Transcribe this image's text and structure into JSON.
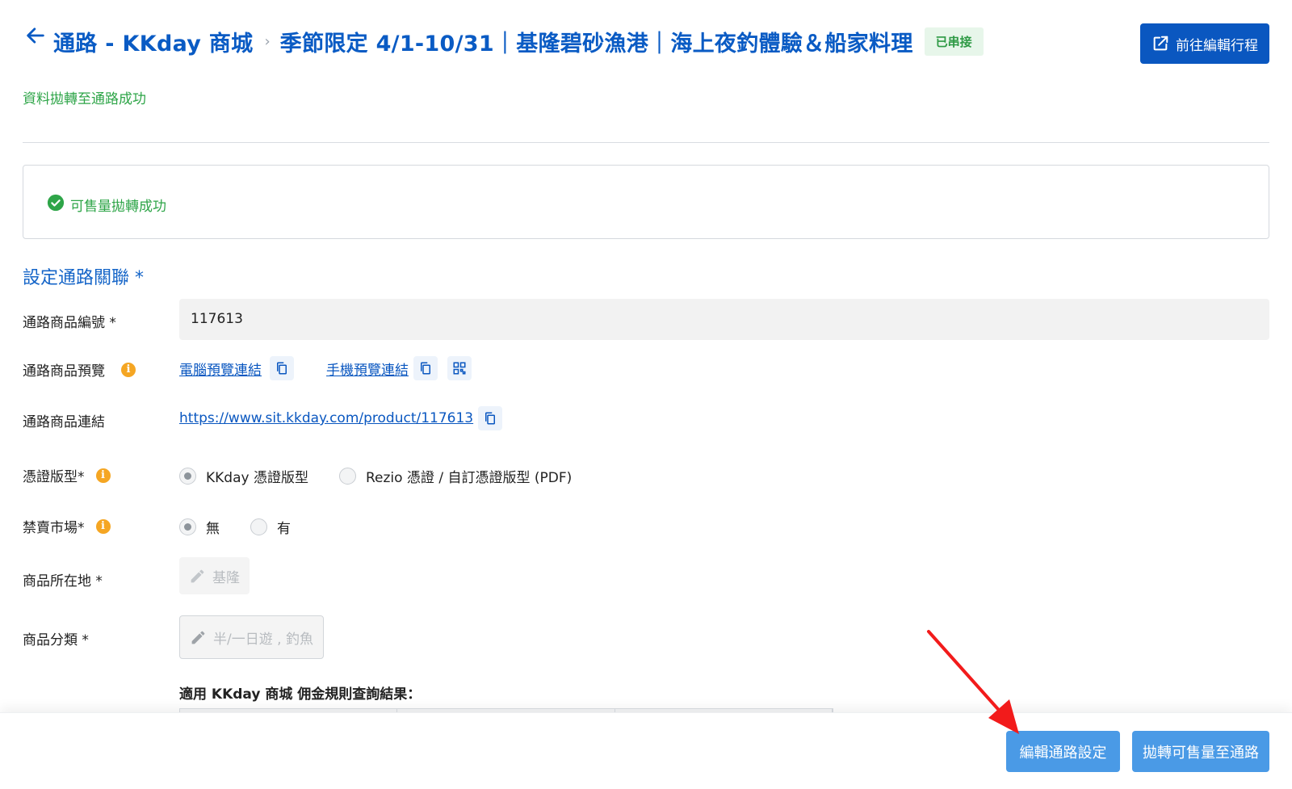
{
  "header": {
    "breadcrumb": [
      "通路 - KKday 商城",
      "季節限定 4/1-10/31｜基隆碧砂漁港｜海上夜釣體驗＆船家料理"
    ],
    "status_badge": "已串接",
    "edit_trip_button": "前往編輯行程"
  },
  "sync_message": "資料拋轉至通路成功",
  "alert": {
    "text": "可售量拋轉成功"
  },
  "section": {
    "title": "設定通路關聯 *",
    "product_id": {
      "label": "通路商品編號 *",
      "value": "117613"
    },
    "preview": {
      "label": "通路商品預覽",
      "desktop_link": "電腦預覽連結",
      "mobile_link": "手機預覽連結"
    },
    "product_link": {
      "label": "通路商品連結",
      "url": "https://www.sit.kkday.com/product/117613"
    },
    "voucher_type": {
      "label": "憑證版型*",
      "options": [
        "KKday 憑證版型",
        "Rezio 憑證 / 自訂憑證版型 (PDF)"
      ],
      "selected": "KKday 憑證版型"
    },
    "banned_market": {
      "label": "禁賣市場*",
      "options": [
        "無",
        "有"
      ],
      "selected": "無"
    },
    "location": {
      "label": "商品所在地 *",
      "value": "基隆"
    },
    "category": {
      "label": "商品分類 *",
      "value": "半/一日遊 , 釣魚"
    },
    "commission_title": "適用 KKday 商城 佣金規則查詢結果："
  },
  "footer": {
    "edit_channel_button": "編輯通路設定",
    "sync_inventory_button": "拋轉可售量至通路"
  },
  "colors": {
    "primary": "#0a57c0",
    "success": "#2ea548",
    "warning": "#f5a623",
    "footer_button": "#4a9ae6",
    "annotation_arrow": "#f21b1b"
  },
  "icons": [
    "arrow-left-icon",
    "external-edit-icon",
    "check-circle-icon",
    "info-icon",
    "copy-icon",
    "qr-code-icon",
    "pencil-icon"
  ]
}
